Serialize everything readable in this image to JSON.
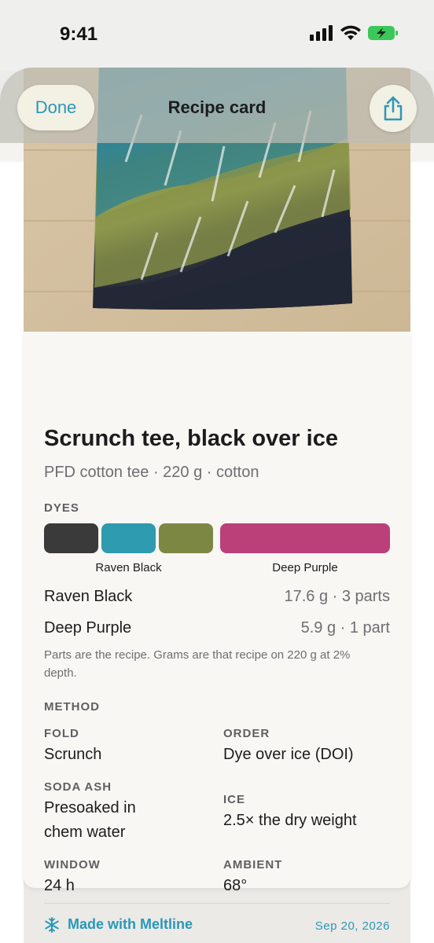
{
  "status_bar": {
    "time": "9:41"
  },
  "nav": {
    "done_label": "Done",
    "title": "Recipe card",
    "share_icon": "share-icon"
  },
  "recipe": {
    "title": "Scrunch tee, black over ice",
    "subtitle": "PFD cotton tee · 220 g · cotton"
  },
  "dyes": {
    "section_label": "DYES",
    "swatch_colors": [
      "#3a3a3a",
      "#2e9bb0",
      "#7d8744",
      "#bb4079"
    ],
    "captions": [
      "Raven Black",
      "Deep Purple"
    ],
    "rows": [
      {
        "name": "Raven Black",
        "amount": "17.6 g · 3 parts"
      },
      {
        "name": "Deep Purple",
        "amount": "5.9 g · 1 part"
      }
    ],
    "note": "Parts are the recipe. Grams are that recipe on 220 g at 2% depth."
  },
  "method": {
    "section_label": "METHOD",
    "fold": {
      "label": "FOLD",
      "value": "Scrunch"
    },
    "order": {
      "label": "ORDER",
      "value": "Dye over ice (DOI)"
    },
    "soda_ash": {
      "label": "SODA ASH",
      "value": "Presoaked in chem water"
    },
    "ice": {
      "label": "ICE",
      "value": "2.5× the dry weight"
    },
    "window": {
      "label": "WINDOW",
      "value": "24 h"
    },
    "ambient": {
      "label": "AMBIENT",
      "value": "68°"
    }
  },
  "footer": {
    "brand": "Made with Meltline",
    "date": "Sep 20, 2026",
    "brand_icon": "snowflake-icon"
  },
  "colors": {
    "accent": "#2a98b8"
  }
}
